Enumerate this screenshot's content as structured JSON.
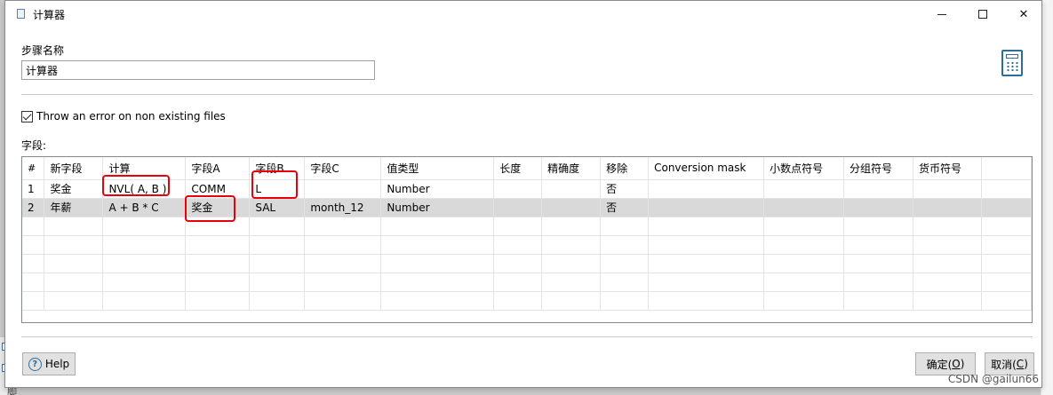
{
  "window": {
    "title": "计算器",
    "minimize_icon": "minimize-icon",
    "maximize_icon": "maximize-icon",
    "close_glyph": "✕"
  },
  "step": {
    "label": "步骤名称",
    "value": "计算器"
  },
  "checkbox": {
    "label": "Throw an error on non existing files",
    "checked": true
  },
  "fields_label": "字段:",
  "table": {
    "columns": [
      "#",
      "新字段",
      "计算",
      "字段A",
      "字段B",
      "字段C",
      "值类型",
      "长度",
      "精确度",
      "移除",
      "Conversion mask",
      "小数点符号",
      "分组符号",
      "货币符号"
    ],
    "rows": [
      [
        "1",
        "奖金",
        "NVL( A, B )",
        "COMM",
        "L",
        "",
        "Number",
        "",
        "",
        "否",
        "",
        "",
        "",
        ""
      ],
      [
        "2",
        "年薪",
        "A + B * C",
        "奖金",
        "SAL",
        "month_12",
        "Number",
        "",
        "",
        "否",
        "",
        "",
        "",
        ""
      ]
    ],
    "selected_row": 2,
    "highlight_color": "#e8000b"
  },
  "buttons": {
    "help": "Help",
    "ok_prefix": "确定(",
    "ok_key": "O",
    "ok_suffix": ")",
    "cancel_prefix": "取消(",
    "cancel_key": "C",
    "cancel_suffix": ")"
  },
  "background": {
    "side_text": "脚本"
  },
  "watermark": "CSDN @gailun66"
}
